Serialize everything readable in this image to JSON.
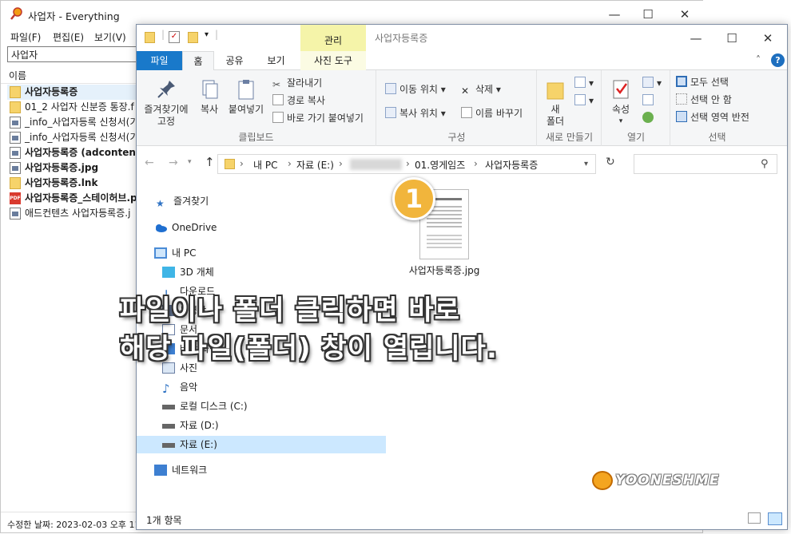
{
  "everything": {
    "title": "사업자 - Everything",
    "menu": [
      "파일(F)",
      "편집(E)",
      "보기(V)"
    ],
    "search_value": "사업자",
    "column_name": "이름",
    "rows": [
      {
        "text": "사업자등록증",
        "icon": "folder-icon"
      },
      {
        "text": "01_2 사업자 신분증 통장.f",
        "icon": "folder-icon"
      },
      {
        "text": "_info_사업자등록 신청서(기",
        "icon": "document-icon"
      },
      {
        "text": "_info_사업자등록 신청서(기",
        "icon": "document-icon"
      },
      {
        "text": "사업자등록증 (adcontents)",
        "icon": "document-icon"
      },
      {
        "text": "사업자등록증.jpg",
        "icon": "image-icon"
      },
      {
        "text": "사업자등록증.lnk",
        "icon": "shortcut-icon"
      },
      {
        "text": "사업자등록증_스테이허브.p",
        "icon": "pdf-icon"
      },
      {
        "text": "애드컨텐츠 사업자등록증.j",
        "icon": "image-icon"
      }
    ],
    "status": "수정한 날짜: 2023-02-03 오후 11"
  },
  "explorer": {
    "manage_label": "관리",
    "title": "사업자등록증",
    "tabs": [
      "파일",
      "홈",
      "공유",
      "보기",
      "사진 도구"
    ],
    "ribbon": {
      "pin_label": "즐겨찾기에\n고정",
      "copy_label": "복사",
      "paste_label": "붙여넣기",
      "cut_label": "잘라내기",
      "copy_path_label": "경로 복사",
      "paste_shortcut_label": "바로 가기 붙여넣기",
      "clipboard_group": "클립보드",
      "move_to_label": "이동 위치",
      "copy_to_label": "복사 위치",
      "delete_label": "삭제",
      "rename_label": "이름 바꾸기",
      "organize_group": "구성",
      "new_folder_label": "새\n폴더",
      "new_group": "새로 만들기",
      "properties_label": "속성",
      "open_group": "열기",
      "select_all_label": "모두 선택",
      "select_none_label": "선택 안 함",
      "invert_selection_label": "선택 영역 반전",
      "select_group": "선택"
    },
    "breadcrumb": [
      "내 PC",
      "자료 (E:)",
      "01.영게임즈",
      "사업자등록증"
    ],
    "nav": [
      {
        "label": "즐겨찾기",
        "icon": "star-icon"
      },
      {
        "label": "OneDrive",
        "icon": "cloud-icon"
      },
      {
        "label": "내 PC",
        "icon": "computer-icon"
      },
      {
        "label": "3D 개체",
        "icon": "cube-icon"
      },
      {
        "label": "다운로드",
        "icon": "download-icon"
      },
      {
        "label": "동영상",
        "icon": "video-icon"
      },
      {
        "label": "문서",
        "icon": "document-icon"
      },
      {
        "label": "바탕 화면",
        "icon": "desktop-icon"
      },
      {
        "label": "사진",
        "icon": "picture-icon"
      },
      {
        "label": "음악",
        "icon": "music-icon"
      },
      {
        "label": "로컬 디스크 (C:)",
        "icon": "drive-icon"
      },
      {
        "label": "자료 (D:)",
        "icon": "drive-icon"
      },
      {
        "label": "자료 (E:)",
        "icon": "drive-icon"
      },
      {
        "label": "네트워크",
        "icon": "network-icon"
      }
    ],
    "file_name": "사업자등록증.jpg",
    "status": "1개 항목"
  },
  "overlay": {
    "line1": "파일이나 폴더 클릭하면 바로",
    "line2": "해당 파일(폴더) 창이 열립니다."
  },
  "badge": "1",
  "watermark": "YOONESHME",
  "colors": {
    "tab_blue": "#1979ca",
    "selection": "#cce8ff",
    "accent_yellow": "#f1b53c"
  }
}
